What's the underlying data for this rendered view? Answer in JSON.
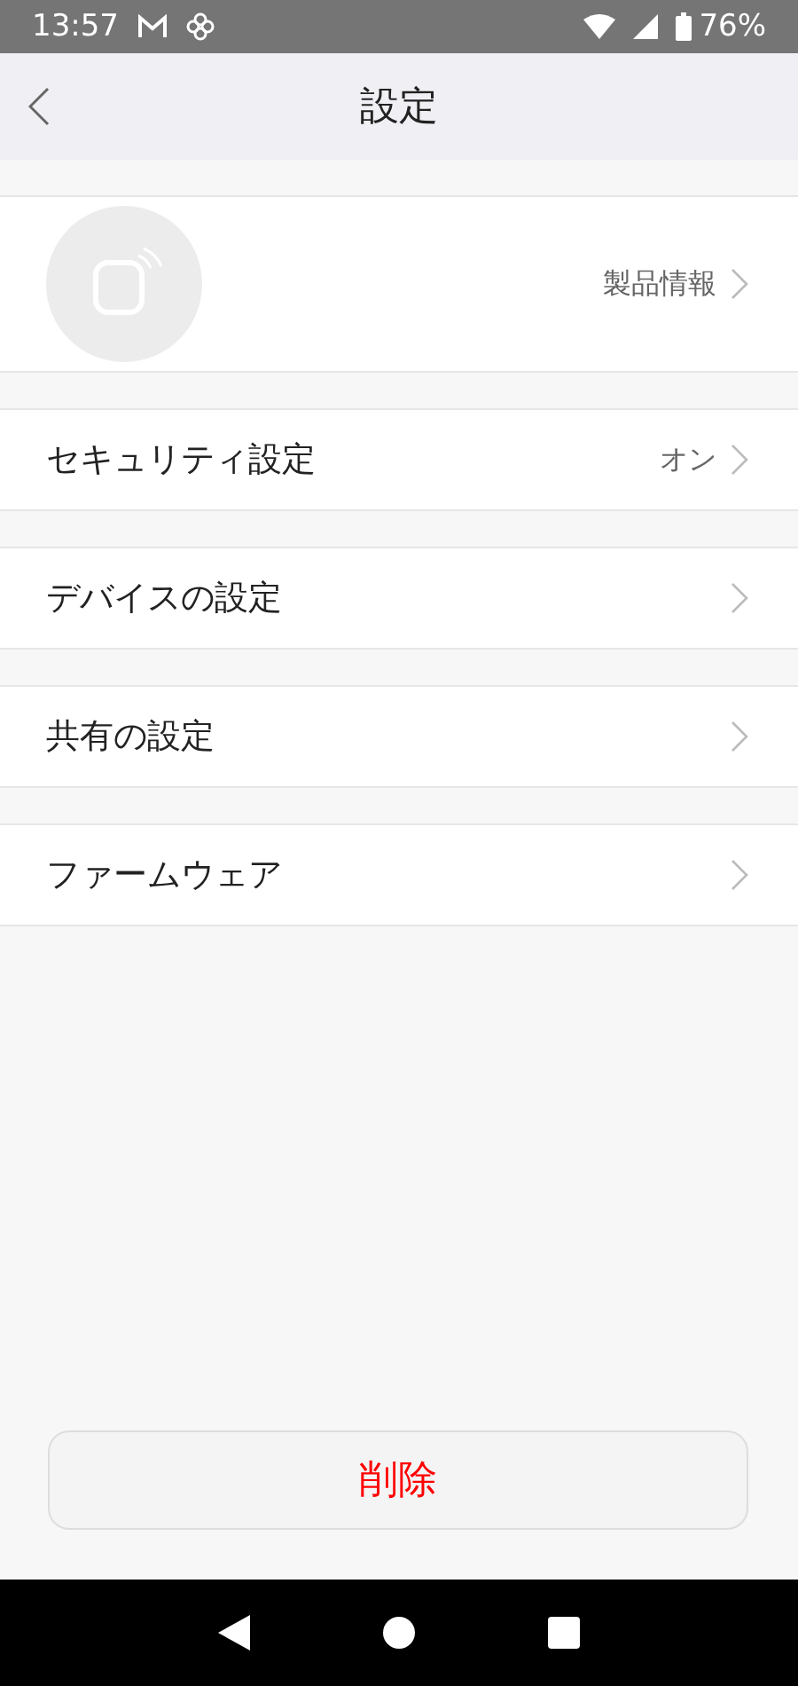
{
  "status_bar": {
    "time": "13:57",
    "battery": "76%"
  },
  "header": {
    "title": "設定"
  },
  "rows": [
    {
      "kind": "product",
      "value": "製品情報"
    },
    {
      "kind": "link",
      "label": "セキュリティ設定",
      "value": "オン"
    },
    {
      "kind": "link",
      "label": "デバイスの設定"
    },
    {
      "kind": "link",
      "label": "共有の設定"
    },
    {
      "kind": "link",
      "label": "ファームウェア"
    }
  ],
  "delete_button": {
    "label": "削除"
  }
}
